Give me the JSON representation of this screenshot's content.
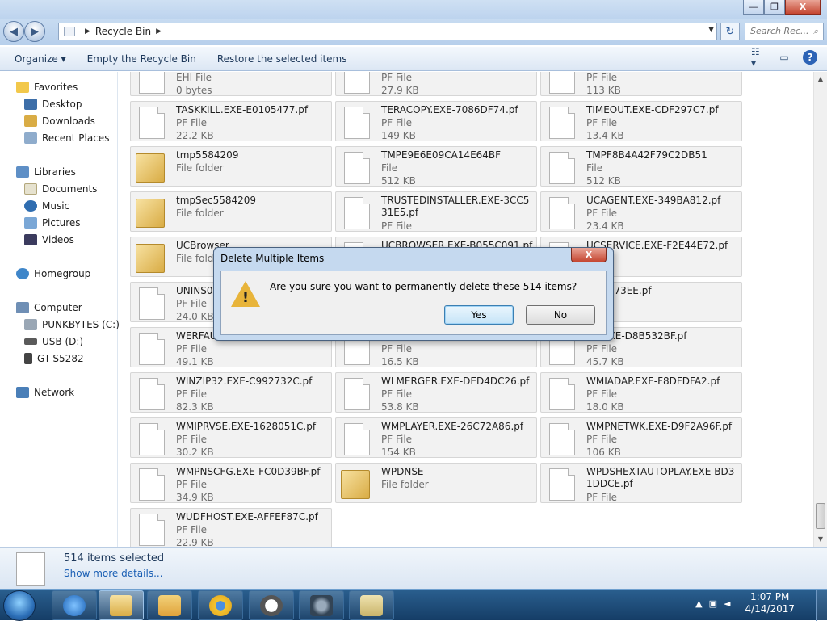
{
  "window": {
    "minimize_glyph": "—",
    "maximize_glyph": "❐",
    "close_glyph": "X"
  },
  "nav": {
    "back_glyph": "◀",
    "forward_glyph": "▶",
    "address": "Recycle Bin",
    "search_placeholder": "Search Rec...",
    "search_glyph": "⌕"
  },
  "toolbar": {
    "organize": "Organize ▾",
    "empty": "Empty the Recycle Bin",
    "restore": "Restore the selected items",
    "help": "?"
  },
  "sidebar": {
    "favorites": "Favorites",
    "desktop": "Desktop",
    "downloads": "Downloads",
    "recent": "Recent Places",
    "libraries": "Libraries",
    "documents": "Documents",
    "music": "Music",
    "pictures": "Pictures",
    "videos": "Videos",
    "homegroup": "Homegroup",
    "computer": "Computer",
    "drive_c": "PUNKBYTES (C:)",
    "drive_d": "USB (D:)",
    "device": "GT-S5282",
    "network": "Network"
  },
  "files": [
    {
      "name": "",
      "type": "EHI File",
      "size": "0 bytes",
      "icon": "file"
    },
    {
      "name": "",
      "type": "PF File",
      "size": "27.9 KB",
      "icon": "file"
    },
    {
      "name": "",
      "type": "PF File",
      "size": "113 KB",
      "icon": "file"
    },
    {
      "name": "TASKKILL.EXE-E0105477.pf",
      "type": "PF File",
      "size": "22.2 KB",
      "icon": "file"
    },
    {
      "name": "TERACOPY.EXE-7086DF74.pf",
      "type": "PF File",
      "size": "149 KB",
      "icon": "file"
    },
    {
      "name": "TIMEOUT.EXE-CDF297C7.pf",
      "type": "PF File",
      "size": "13.4 KB",
      "icon": "file"
    },
    {
      "name": "tmp5584209",
      "type": "File folder",
      "size": "",
      "icon": "folder"
    },
    {
      "name": "TMPE9E6E09CA14E64BF",
      "type": "File",
      "size": "512 KB",
      "icon": "file"
    },
    {
      "name": "TMPF8B4A42F79C2DB51",
      "type": "File",
      "size": "512 KB",
      "icon": "file"
    },
    {
      "name": "tmpSec5584209",
      "type": "File folder",
      "size": "",
      "icon": "folder"
    },
    {
      "name": "TRUSTEDINSTALLER.EXE-3CC531E5.pf",
      "type": "PF File",
      "size": "",
      "icon": "file"
    },
    {
      "name": "UCAGENT.EXE-349BA812.pf",
      "type": "PF File",
      "size": "23.4 KB",
      "icon": "file"
    },
    {
      "name": "UCBrowser",
      "type": "File folder",
      "size": "",
      "icon": "folder"
    },
    {
      "name": "UCBROWSER.EXE-B055C091.pf",
      "type": "",
      "size": "",
      "icon": "file"
    },
    {
      "name": "UCSERVICE.EXE-F2E44E72.pf",
      "type": "",
      "size": "",
      "icon": "file"
    },
    {
      "name": "UNINS000.EXE-A11F73EE.pf",
      "type": "PF File",
      "size": "24.0 KB",
      "icon": "file"
    },
    {
      "name": "",
      "type": "",
      "size": "",
      "icon": "file"
    },
    {
      "name": "-A11F73EE.pf",
      "type": "",
      "size": "",
      "icon": "file"
    },
    {
      "name": "WERFAULT.EXE",
      "type": "PF File",
      "size": "49.1 KB",
      "icon": "file"
    },
    {
      "name": "",
      "type": "PF File",
      "size": "16.5 KB",
      "icon": "file"
    },
    {
      "name": "AR.EXE-D8B532BF.pf",
      "type": "PF File",
      "size": "45.7 KB",
      "icon": "file"
    },
    {
      "name": "WINZIP32.EXE-C992732C.pf",
      "type": "PF File",
      "size": "82.3 KB",
      "icon": "file"
    },
    {
      "name": "WLMERGER.EXE-DED4DC26.pf",
      "type": "PF File",
      "size": "53.8 KB",
      "icon": "file"
    },
    {
      "name": "WMIADAP.EXE-F8DFDFA2.pf",
      "type": "PF File",
      "size": "18.0 KB",
      "icon": "file"
    },
    {
      "name": "WMIPRVSE.EXE-1628051C.pf",
      "type": "PF File",
      "size": "30.2 KB",
      "icon": "file"
    },
    {
      "name": "WMPLAYER.EXE-26C72A86.pf",
      "type": "PF File",
      "size": "154 KB",
      "icon": "file"
    },
    {
      "name": "WMPNETWK.EXE-D9F2A96F.pf",
      "type": "PF File",
      "size": "106 KB",
      "icon": "file"
    },
    {
      "name": "WMPNSCFG.EXE-FC0D39BF.pf",
      "type": "PF File",
      "size": "34.9 KB",
      "icon": "file"
    },
    {
      "name": "WPDNSE",
      "type": "File folder",
      "size": "",
      "icon": "folder"
    },
    {
      "name": "WPDSHEXTAUTOPLAY.EXE-BD31DDCE.pf",
      "type": "PF File",
      "size": "",
      "icon": "file"
    },
    {
      "name": "WUDFHOST.EXE-AFFEF87C.pf",
      "type": "PF File",
      "size": "22.9 KB",
      "icon": "file"
    }
  ],
  "details": {
    "selected": "514 items selected",
    "more": "Show more details..."
  },
  "dialog": {
    "title": "Delete Multiple Items",
    "close_glyph": "X",
    "message": "Are you sure you want to permanently delete these 514 items?",
    "warning_glyph": "!",
    "yes": "Yes",
    "no": "No"
  },
  "taskbar": {
    "time": "1:07 PM",
    "date": "4/14/2017",
    "tray_arrow": "▲"
  },
  "colors": {
    "folder": "#e1bc5c",
    "accent": "#2c63b6"
  }
}
